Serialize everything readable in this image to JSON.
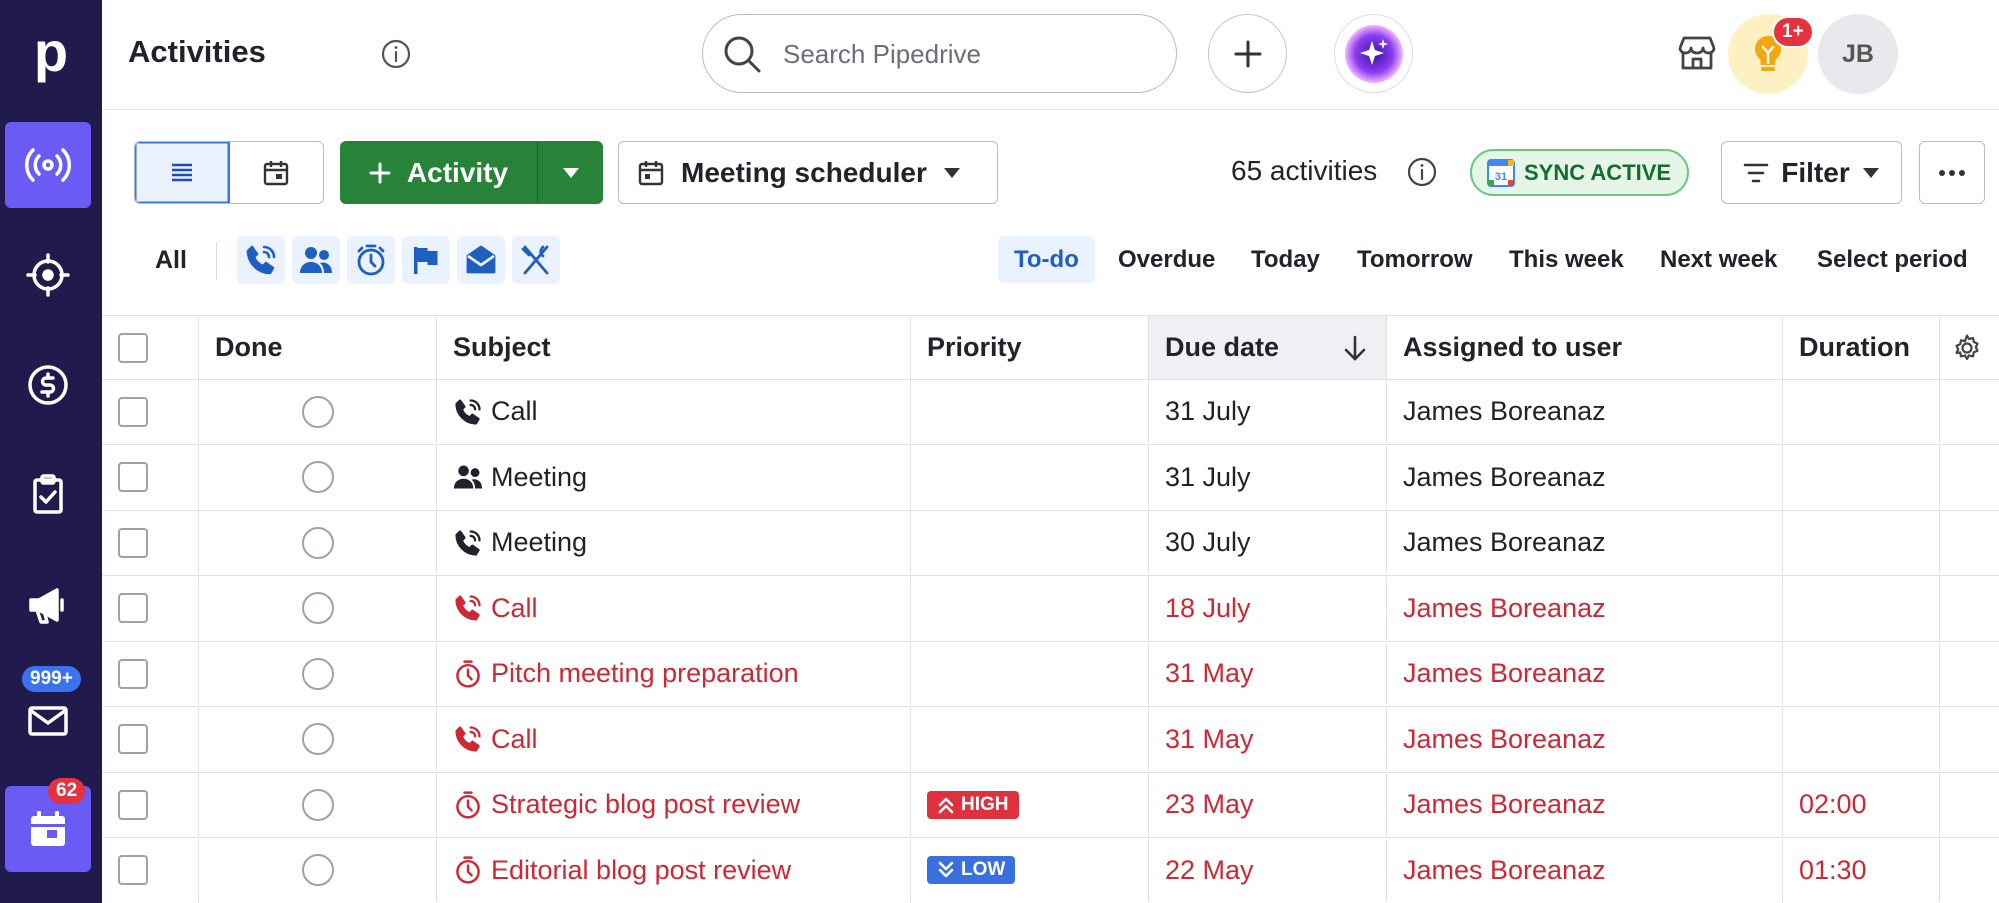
{
  "sidebar": {
    "logo": "p",
    "items": [
      {
        "name": "radio-icon",
        "active": true
      },
      {
        "name": "target-icon"
      },
      {
        "name": "dollar-icon"
      },
      {
        "name": "clipboard-check-icon"
      },
      {
        "name": "megaphone-icon"
      },
      {
        "name": "mail-icon",
        "badge": "999+"
      },
      {
        "name": "calendar-icon",
        "badge": "62",
        "active": true
      }
    ],
    "mail_badge": "999+",
    "calendar_badge": "62"
  },
  "header": {
    "title": "Activities",
    "search_placeholder": "Search Pipedrive",
    "notif_badge": "1+",
    "avatar_initials": "JB"
  },
  "toolbar": {
    "add_label": "Activity",
    "scheduler_label": "Meeting scheduler",
    "count_label": "65 activities",
    "sync_label": "SYNC ACTIVE",
    "filter_label": "Filter"
  },
  "type_filter": {
    "all_label": "All",
    "types": [
      "call-icon",
      "meeting-icon",
      "task-icon",
      "deadline-icon",
      "email-icon",
      "lunch-icon"
    ]
  },
  "periods": [
    "To-do",
    "Overdue",
    "Today",
    "Tomorrow",
    "This week",
    "Next week",
    "Select period"
  ],
  "table": {
    "columns": [
      "Done",
      "Subject",
      "Priority",
      "Due date",
      "Assigned to user",
      "Duration"
    ],
    "rows": [
      {
        "icon": "call-icon",
        "subject": "Call",
        "priority": "",
        "due": "31 July",
        "user": "James Boreanaz",
        "duration": "",
        "overdue": false
      },
      {
        "icon": "meeting-icon",
        "subject": "Meeting",
        "priority": "",
        "due": "31 July",
        "user": "James Boreanaz",
        "duration": "",
        "overdue": false
      },
      {
        "icon": "call-icon",
        "subject": "Meeting",
        "priority": "",
        "due": "30 July",
        "user": "James Boreanaz",
        "duration": "",
        "overdue": false
      },
      {
        "icon": "call-icon",
        "subject": "Call",
        "priority": "",
        "due": "18 July",
        "user": "James Boreanaz",
        "duration": "",
        "overdue": true
      },
      {
        "icon": "task-icon",
        "subject": "Pitch meeting preparation",
        "priority": "",
        "due": "31 May",
        "user": "James Boreanaz",
        "duration": "",
        "overdue": true
      },
      {
        "icon": "call-icon",
        "subject": "Call",
        "priority": "",
        "due": "31 May",
        "user": "James Boreanaz",
        "duration": "",
        "overdue": true
      },
      {
        "icon": "task-icon",
        "subject": "Strategic blog post review",
        "priority": "HIGH",
        "due": "23 May",
        "user": "James Boreanaz",
        "duration": "02:00",
        "overdue": true
      },
      {
        "icon": "task-icon",
        "subject": "Editorial blog post review",
        "priority": "LOW",
        "due": "22 May",
        "user": "James Boreanaz",
        "duration": "01:30",
        "overdue": true
      }
    ]
  },
  "colors": {
    "sidebar": "#211a4c",
    "accent": "#6b5bf5",
    "primary_green": "#268338",
    "overdue_red": "#cc2936",
    "link_blue": "#1f5fbf"
  }
}
